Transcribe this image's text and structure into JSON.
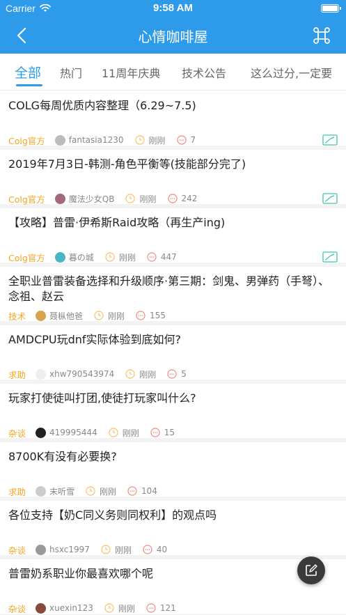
{
  "status_bar": {
    "carrier": "Carrier",
    "time": "9:58 AM"
  },
  "nav": {
    "title": "心情咖啡屋"
  },
  "tabs": [
    {
      "label": "全部"
    },
    {
      "label": "热门"
    },
    {
      "label": "11周年庆典"
    },
    {
      "label": "技术公告"
    },
    {
      "label": "这么过分,一定要"
    }
  ],
  "colors": {
    "brand": "#2d9bea",
    "tag": "#f5a623",
    "image_flag": "#3cc8a8"
  },
  "posts": [
    {
      "title": "COLG每周优质内容整理（6.29~7.5)",
      "tag": "Colg官方",
      "author": "fantasia1230",
      "time": "刚刚",
      "comments": "7",
      "has_image": true,
      "avatar_color": "#bbbbbb"
    },
    {
      "title": "2019年7月3日-韩测-角色平衡等(技能部分完了)",
      "tag": "Colg官方",
      "author": "魔法少女QB",
      "time": "刚刚",
      "comments": "242",
      "has_image": true,
      "avatar_color": "#a06a7a"
    },
    {
      "title": "【攻略】普雷·伊希斯Raid攻略（再生产ing)",
      "tag": "Colg官方",
      "author": "暮の城",
      "time": "刚刚",
      "comments": "447",
      "has_image": true,
      "avatar_color": "#49b6c4"
    },
    {
      "title": "全职业普雷装备选择和升级顺序·第三期：剑鬼、男弹药（手弩）、念祖、赵云",
      "tag": "技术",
      "author": "聂枞他爸",
      "time": "刚刚",
      "comments": "155",
      "has_image": false,
      "avatar_color": "#d8a34c"
    },
    {
      "title": "AMDCPU玩dnf实际体验到底如何?",
      "tag": "求助",
      "author": "xhw790543974",
      "time": "刚刚",
      "comments": "5",
      "has_image": false,
      "avatar_color": "#eeeeee"
    },
    {
      "title": "玩家打使徒叫打团,使徒打玩家叫什么?",
      "tag": "杂谈",
      "author": "419995444",
      "time": "刚刚",
      "comments": "15",
      "has_image": false,
      "avatar_color": "#222222"
    },
    {
      "title": "8700K有没有必要换?",
      "tag": "求助",
      "author": "末听雪",
      "time": "刚刚",
      "comments": "104",
      "has_image": false,
      "avatar_color": "#cccccc"
    },
    {
      "title": "各位支持【奶C同义务则同权利】的观点吗",
      "tag": "杂谈",
      "author": "hsxc1997",
      "time": "刚刚",
      "comments": "40",
      "has_image": false,
      "avatar_color": "#999999"
    },
    {
      "title": "普雷奶系职业你最喜欢哪个呢",
      "tag": "杂谈",
      "author": "xuexin123",
      "time": "刚刚",
      "comments": "121",
      "has_image": false,
      "avatar_color": "#8a4a3a"
    }
  ],
  "icons": {
    "back": "chevron-left-icon",
    "command": "command-icon",
    "clock": "clock-icon",
    "comment": "comment-bubble-icon",
    "image": "image-icon",
    "compose": "compose-icon",
    "wifi": "wifi-icon",
    "battery": "battery-icon"
  }
}
